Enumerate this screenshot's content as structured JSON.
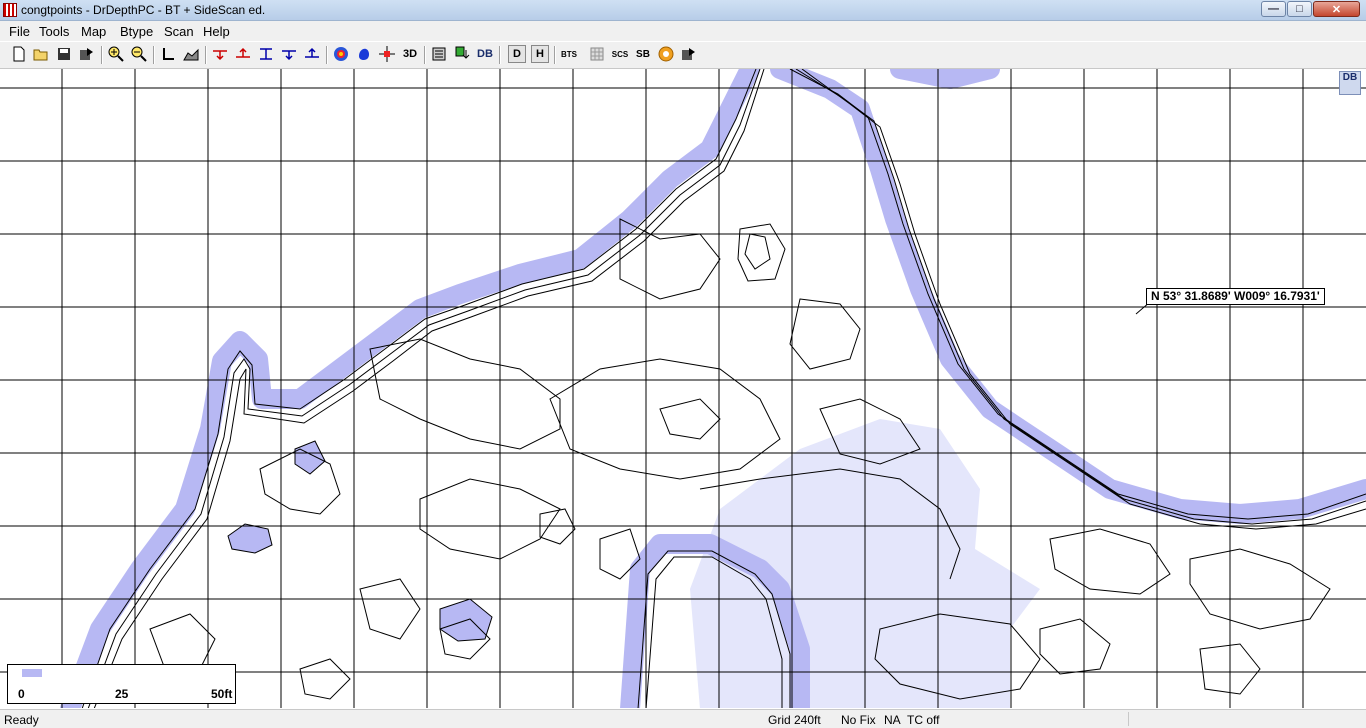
{
  "window": {
    "title": "congtpoints - DrDepthPC - BT + SideScan ed.",
    "min_label": "—",
    "max_label": "□",
    "close_label": "✕"
  },
  "menu": [
    "File",
    "Tools",
    "Map",
    "Btype",
    "Scan",
    "Help"
  ],
  "toolbar": {
    "icons": [
      "new-file-icon",
      "open-folder-icon",
      "save-icon",
      "export-icon",
      "zoom-in-icon",
      "zoom-out-icon",
      "line-tool-icon",
      "area-tool-icon",
      "depth-marker-down-icon",
      "depth-marker-up-icon",
      "depth-range-icon",
      "marker-down-blue-icon",
      "marker-up-blue-icon",
      "color-map-icon",
      "blob-icon",
      "crosshair-icon",
      "3d-view-icon",
      "list-icon",
      "waypoint-icon",
      "db-icon",
      "d-toggle-icon",
      "h-toggle-icon",
      "bts-icon",
      "grid-toggle-icon",
      "scs-icon",
      "sb-icon",
      "record-icon",
      "settings-export-icon"
    ],
    "view_3d_label": "3D",
    "bts_label": "BTS",
    "scs_label": "SCS",
    "sb_label": "SB",
    "db_label": "DB",
    "d_label": "D",
    "h_label": "H"
  },
  "map": {
    "coordinate_readout": "N 53° 31.8689' W009° 16.7931'",
    "scale": {
      "ticks": [
        "0",
        "25",
        "50ft"
      ]
    },
    "logo_text": "DB",
    "colors": {
      "shallow_fill": "#b7b8f3",
      "light_fill": "#e4e6fb",
      "contour": "#000000",
      "grid": "#000000"
    }
  },
  "status": {
    "ready": "Ready",
    "grid": "Grid 240ft",
    "fix": "No Fix",
    "na": "NA",
    "tc": "TC off"
  }
}
